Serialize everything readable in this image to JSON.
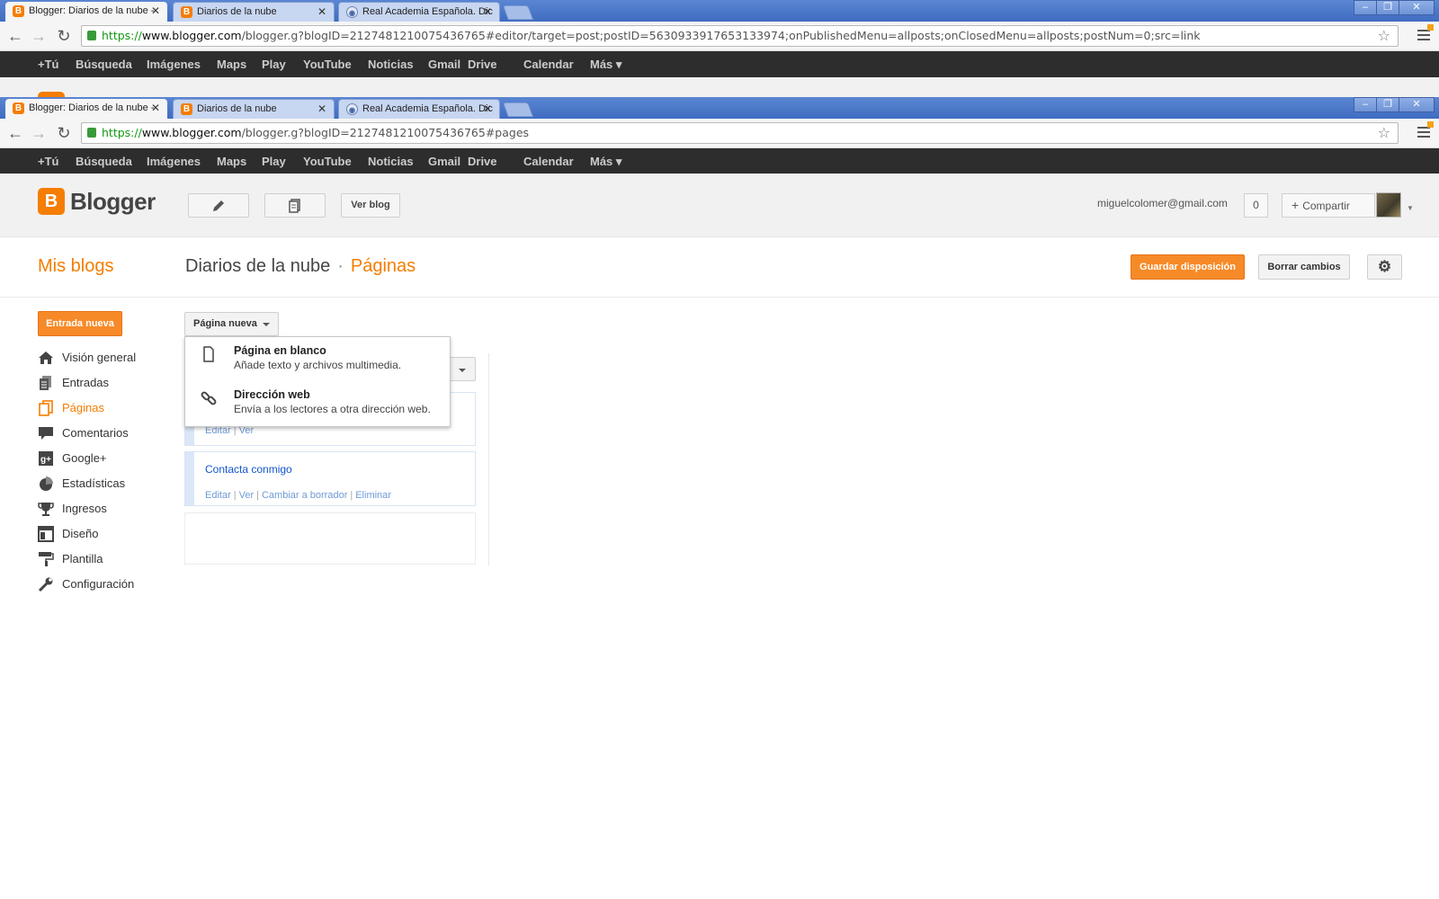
{
  "browser_back": {
    "tabs": [
      {
        "title": "Blogger: Diarios de la nube -",
        "favicon": "blogger-favicon"
      },
      {
        "title": "Diarios de la nube",
        "favicon": "blogger-favicon"
      },
      {
        "title": "Real Academia Española. Dic",
        "favicon": "rae-favicon"
      }
    ],
    "url_scheme": "https://",
    "url_host": "www.blogger.com",
    "url_path": "/blogger.g?blogID=2127481210075436765#editor/target=post;postID=5630933917653133974;onPublishedMenu=allposts;onClosedMenu=allposts;postNum=0;src=link"
  },
  "browser_front": {
    "tabs": [
      {
        "title": "Blogger: Diarios de la nube -",
        "favicon": "blogger-favicon"
      },
      {
        "title": "Diarios de la nube",
        "favicon": "blogger-favicon"
      },
      {
        "title": "Real Academia Española. Dic",
        "favicon": "rae-favicon"
      }
    ],
    "url_scheme": "https://",
    "url_host": "www.blogger.com",
    "url_path": "/blogger.g?blogID=2127481210075436765#pages"
  },
  "google_bar": [
    "+Tú",
    "Búsqueda",
    "Imágenes",
    "Maps",
    "Play",
    "YouTube",
    "Noticias",
    "Gmail",
    "Drive",
    "Calendar",
    "Más ▾"
  ],
  "blogger_header": {
    "logo_letter": "B",
    "logo_text": "Blogger",
    "view_blog": "Ver blog",
    "email": "miguelcolomer@gmail.com",
    "notif_count": "0",
    "share": "Compartir"
  },
  "subheader": {
    "my_blogs": "Mis blogs",
    "blog_name": "Diarios de la nube",
    "separator": "·",
    "section": "Páginas",
    "save_layout": "Guardar disposición",
    "discard": "Borrar cambios"
  },
  "sidebar": {
    "new_post": "Entrada nueva",
    "items": [
      {
        "label": "Visión general",
        "icon": "home-icon"
      },
      {
        "label": "Entradas",
        "icon": "posts-icon"
      },
      {
        "label": "Páginas",
        "icon": "pages-icon",
        "selected": true
      },
      {
        "label": "Comentarios",
        "icon": "comment-icon"
      },
      {
        "label": "Google+",
        "icon": "google-plus-icon"
      },
      {
        "label": "Estadísticas",
        "icon": "stats-icon"
      },
      {
        "label": "Ingresos",
        "icon": "trophy-icon"
      },
      {
        "label": "Diseño",
        "icon": "layout-icon"
      },
      {
        "label": "Plantilla",
        "icon": "paint-roller-icon"
      },
      {
        "label": "Configuración",
        "icon": "wrench-icon"
      }
    ]
  },
  "pages_panel": {
    "new_page_button": "Página nueva",
    "menu": [
      {
        "title": "Página en blanco",
        "desc": "Añade texto y archivos multimedia.",
        "icon": "blank-page-icon"
      },
      {
        "title": "Dirección web",
        "desc": "Envía a los lectores a otra dirección web.",
        "icon": "link-icon"
      }
    ],
    "page1_links": [
      "Editar",
      "Ver"
    ],
    "page2": {
      "title": "Contacta conmigo",
      "links": [
        "Editar",
        "Ver",
        "Cambiar a borrador",
        "Eliminar"
      ]
    }
  },
  "colors": {
    "accent": "#f57d00",
    "link": "#1155cc",
    "gbar": "#2d2d2d"
  }
}
